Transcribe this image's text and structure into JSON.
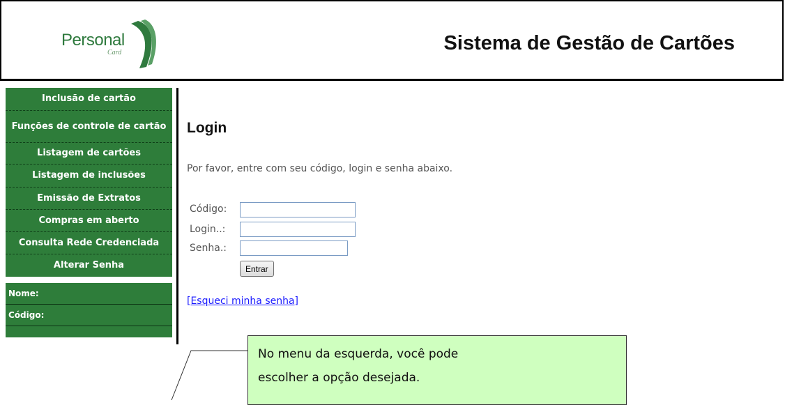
{
  "header": {
    "logo_text": "Personal",
    "logo_sub": "Card",
    "title": "Sistema de Gestão de Cartões"
  },
  "menu": {
    "items": [
      {
        "label": "Inclusão de cartão"
      },
      {
        "label": "Funções de controle de cartão"
      },
      {
        "label": "Listagem de cartões"
      },
      {
        "label": "Listagem de inclusões"
      },
      {
        "label": "Emissão de Extratos"
      },
      {
        "label": "Compras em aberto"
      },
      {
        "label": "Consulta Rede Credenciada"
      },
      {
        "label": "Alterar Senha"
      }
    ]
  },
  "info": {
    "name_label": "Nome:",
    "code_label": "Código:"
  },
  "login": {
    "title": "Login",
    "description": "Por favor, entre com seu código, login e senha abaixo.",
    "code_label": "Código:",
    "login_label": "Login..:",
    "password_label": "Senha.:",
    "code_value": "",
    "login_value": "",
    "password_value": "",
    "submit_label": "Entrar",
    "forgot_link": "[Esqueci minha senha]"
  },
  "callout": {
    "line1": "No menu da esquerda, você pode",
    "line2": "escolher a opção desejada."
  },
  "colors": {
    "menu_green": "#2e7d3a",
    "callout_bg": "#cfffbf",
    "link_blue": "#1a1aff"
  }
}
